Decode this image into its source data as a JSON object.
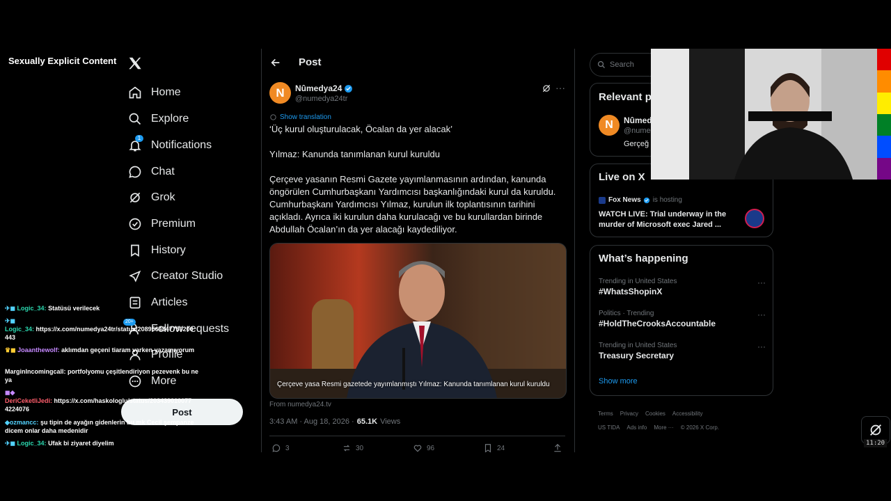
{
  "overlay": {
    "label": "Sexually Explicit Content"
  },
  "nav": {
    "items": [
      {
        "label": "Home",
        "icon": "home-icon"
      },
      {
        "label": "Explore",
        "icon": "search-icon"
      },
      {
        "label": "Notifications",
        "icon": "bell-icon",
        "badge": "1"
      },
      {
        "label": "Chat",
        "icon": "chat-icon"
      },
      {
        "label": "Grok",
        "icon": "grok-icon"
      },
      {
        "label": "Premium",
        "icon": "premium-icon"
      },
      {
        "label": "History",
        "icon": "bookmark-icon"
      },
      {
        "label": "Creator Studio",
        "icon": "rocket-icon"
      },
      {
        "label": "Articles",
        "icon": "articles-icon"
      },
      {
        "label": "Follow requests",
        "icon": "follow-requests-icon",
        "badge": "20+"
      },
      {
        "label": "Profile",
        "icon": "profile-icon"
      },
      {
        "label": "More",
        "icon": "more-icon"
      }
    ],
    "post_label": "Post"
  },
  "chat": [
    {
      "user": "Logic_34:",
      "text": "Statüsü verilecek"
    },
    {
      "user": "Logic_34:",
      "text": "https://x.com/numedya24tr/status/2089564347759200 443"
    },
    {
      "user": "Joaanthewolf:",
      "text": "aklımdan geçeni tiaram varken yazamıyorum"
    },
    {
      "user": "MarginIncomingcall:",
      "text": "portfolyomu çeşitlendiriyon pezevenk bu ne ya"
    },
    {
      "user": "DeriCeketliJedi:",
      "text": "https://x.com/haskologlu/status/203439010077 4224076"
    },
    {
      "user": "ozmancc:",
      "text": "şu tipin de ayağın gidenlerin bu mk Cecil şempanze dicem onlar daha medenidir"
    },
    {
      "user": "Logic_34:",
      "text": "Ufak bi ziyaret diyelim"
    }
  ],
  "header": {
    "title": "Post"
  },
  "tweet": {
    "name": "Nûmedya24",
    "handle": "@numedya24tr",
    "avatar_letter": "N",
    "translation": "Show translation",
    "paragraphs": [
      "‘Üç kurul oluşturulacak, Öcalan da yer alacak’",
      "Yılmaz: Kanunda tanımlanan kurul kuruldu",
      "Çerçeve yasanın Resmi Gazete yayımlanmasının ardından, kanunda öngörülen Cumhurbaşkanı Yardımcısı başkanlığındaki kurul da kuruldu. Cumhurbaşkanı Yardımcısı Yılmaz, kurulun ilk toplantısının tarihini açıkladı. Ayrıca iki kurulun daha kurulacağı ve bu kurullardan birinde Abdullah Öcalan’ın da yer alacağı kaydediliyor."
    ],
    "image_caption": "Çerçeve yasa Resmi gazetede yayımlanmıştı Yılmaz: Kanunda tanımlanan kurul kuruldu",
    "source": "From numedya24.tv",
    "time": "3:43 AM · Aug 18, 2026 ·",
    "views_count": "65.1K",
    "views_label": "Views",
    "replies": "3",
    "reposts": "30",
    "likes": "96",
    "bookmarks": "24"
  },
  "right": {
    "search_placeholder": "Search",
    "relevant_title": "Relevant p",
    "relevant_name": "Nûmed",
    "relevant_handle": "@nume",
    "relevant_bio": "Gerçeğ",
    "live_title": "Live on X",
    "live_source": "Fox News",
    "live_status": "is hosting",
    "live_text": "WATCH LIVE: Trial underway in the murder of Microsoft exec Jared ...",
    "happening_title": "What’s happening",
    "trends": [
      {
        "meta": "Trending in United States",
        "title": "#WhatsShopinX"
      },
      {
        "meta": "Politics · Trending",
        "title": "#HoldTheCrooksAccountable"
      },
      {
        "meta": "Trending in United States",
        "title": "Treasury Secretary"
      }
    ],
    "show_more": "Show more",
    "footer": [
      "Terms",
      "Privacy",
      "Cookies",
      "Accessibility",
      "US TIDA",
      "Ads info",
      "More ···",
      "© 2026 X Corp."
    ]
  },
  "clock": "11:20",
  "colors": {
    "accent": "#1d9bf0",
    "background": "#000000",
    "border": "#2f3336",
    "muted": "#71767b"
  }
}
